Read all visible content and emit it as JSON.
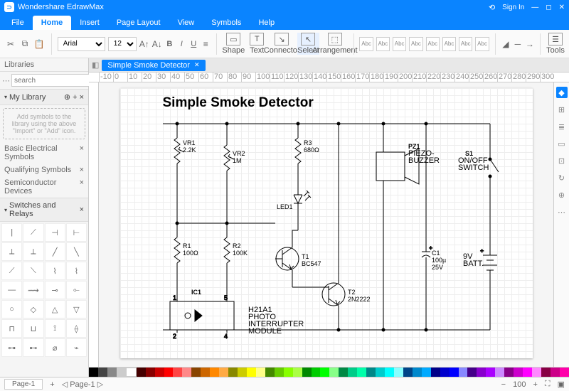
{
  "app": {
    "name": "Wondershare EdrawMax",
    "signin": "Sign In"
  },
  "menu": {
    "file": "File",
    "home": "Home",
    "insert": "Insert",
    "pagelayout": "Page Layout",
    "view": "View",
    "symbols": "Symbols",
    "help": "Help"
  },
  "ribbon": {
    "font": "Arial",
    "size": "12",
    "shape": "Shape",
    "text": "Text",
    "connector": "Connector",
    "select": "Select",
    "arrangement": "Arrangement",
    "style": "Abc",
    "tools": "Tools"
  },
  "left": {
    "libraries": "Libraries",
    "searchPlaceholder": "search",
    "mylib": "My Library",
    "hint": "Add symbols to the library using the above \"Import\" or \"Add\" icon.",
    "s1": "Basic Electrical Symbols",
    "s2": "Qualifying Symbols",
    "s3": "Semiconductor Devices",
    "s4": "Switches and Relays"
  },
  "doc": {
    "tab": "Simple Smoke Detector",
    "title": "Simple Smoke Detector"
  },
  "circuit": {
    "vr1": "VR1",
    "vr1v": "2.2K",
    "vr2": "VR2",
    "vr2v": "1M",
    "r3": "R3",
    "r3v": "680Ω",
    "r1": "R1",
    "r1v": "100Ω",
    "r2": "R2",
    "r2v": "100K",
    "led1": "LED1",
    "t1": "T1",
    "t1v": "BC547",
    "t2": "T2",
    "t2v": "2N2222",
    "ic1": "IC1",
    "module": "H21A1\nPHOTO\nINTERRUPTER\nMODULE",
    "pz1": "PZ1",
    "pz1v": "PIEZO-\nBUZZER",
    "s1": "S1",
    "s1v": "ON/OFF\nSWITCH",
    "c1": "C1",
    "c1v": "100µ",
    "c1v2": "25V",
    "batt": "9V\nBATT."
  },
  "status": {
    "page": "Page-1",
    "zoom": "100"
  }
}
